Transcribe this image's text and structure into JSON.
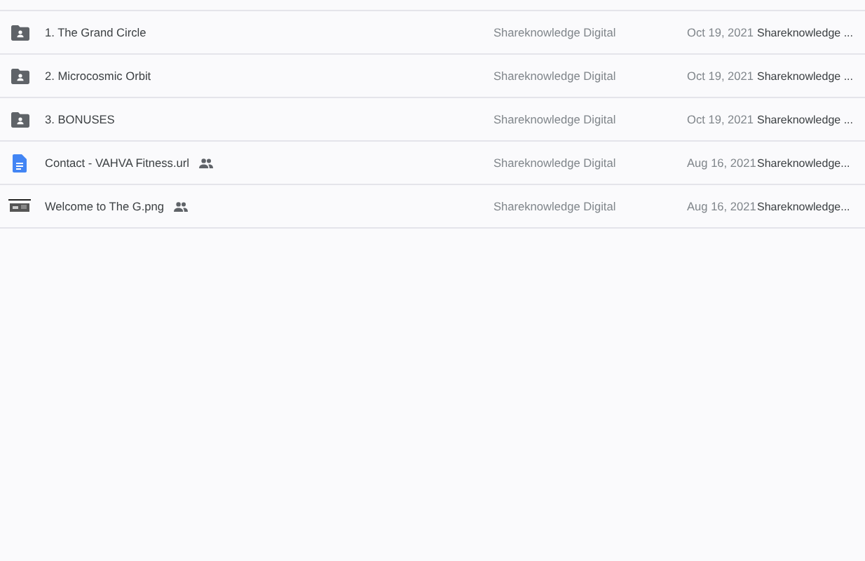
{
  "files": [
    {
      "kind": "folder",
      "name": "1. The Grand Circle",
      "shared": false,
      "owner": "Shareknowledge Digital",
      "date": "Oct 19, 2021",
      "modified_by": "Shareknowledge ..."
    },
    {
      "kind": "folder",
      "name": "2. Microcosmic Orbit",
      "shared": false,
      "owner": "Shareknowledge Digital",
      "date": "Oct 19, 2021",
      "modified_by": "Shareknowledge ..."
    },
    {
      "kind": "folder",
      "name": "3. BONUSES",
      "shared": false,
      "owner": "Shareknowledge Digital",
      "date": "Oct 19, 2021",
      "modified_by": "Shareknowledge ..."
    },
    {
      "kind": "document",
      "name": "Contact - VAHVA Fitness.url",
      "shared": true,
      "owner": "Shareknowledge Digital",
      "date": "Aug 16, 2021",
      "modified_by": "Shareknowledge..."
    },
    {
      "kind": "image",
      "name": "Welcome to The G.png",
      "shared": true,
      "owner": "Shareknowledge Digital",
      "date": "Aug 16, 2021",
      "modified_by": "Shareknowledge..."
    }
  ]
}
